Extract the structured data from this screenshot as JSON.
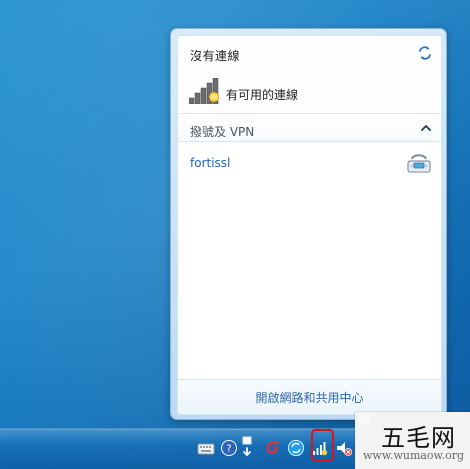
{
  "network_popup": {
    "status_title": "沒有連線",
    "status_subtitle": "有可用的連線",
    "group_title": "撥號及 VPN",
    "vpn_connection": "fortissl",
    "footer_link": "開啟網路和共用中心"
  },
  "icons": {
    "refresh": "refresh-icon",
    "signal": "signal-warning-icon",
    "collapse": "chevron-up-icon",
    "vpn": "vpn-phone-icon",
    "keyboard": "keyboard-icon",
    "help": "help-icon",
    "window": "window-icon",
    "red_app": "red-app-icon",
    "sync": "sync-icon",
    "network": "network-icon",
    "speaker": "speaker-icon"
  },
  "watermark": {
    "title": "五毛网",
    "subtitle": "www.wumaow.org"
  },
  "colors": {
    "desktop": "#1b7fc5",
    "popup_text": "#1f1f1f",
    "vpn_link": "#1f65b8",
    "footer_link": "#2f66ab",
    "highlight": "#d9141b"
  }
}
